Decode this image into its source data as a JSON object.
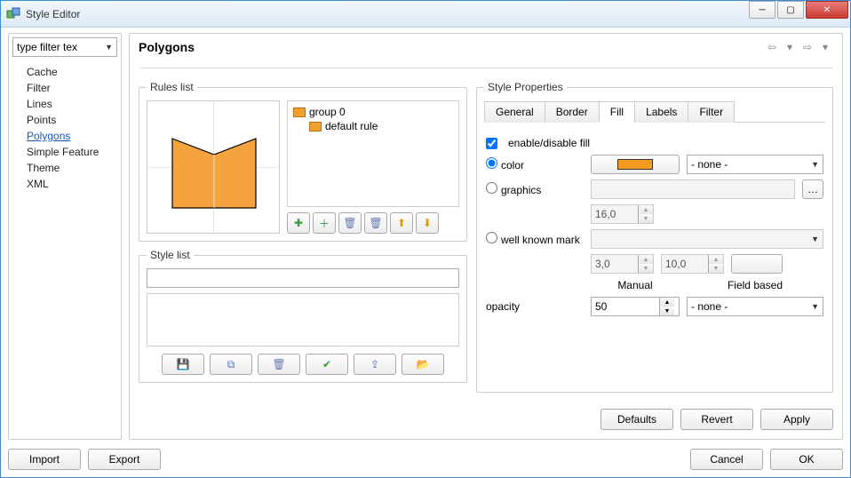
{
  "window": {
    "title": "Style Editor"
  },
  "sidebar": {
    "filter_placeholder": "type filter tex",
    "items": [
      {
        "label": "Cache"
      },
      {
        "label": "Filter"
      },
      {
        "label": "Lines"
      },
      {
        "label": "Points"
      },
      {
        "label": "Polygons",
        "selected": true
      },
      {
        "label": "Simple Feature"
      },
      {
        "label": "Theme"
      },
      {
        "label": "XML"
      }
    ]
  },
  "page": {
    "title": "Polygons"
  },
  "rules": {
    "legend": "Rules list",
    "tree": {
      "group_label": "group 0",
      "rule_label": "default rule"
    }
  },
  "style_list": {
    "legend": "Style list"
  },
  "props": {
    "legend": "Style Properties",
    "tabs": {
      "general": "General",
      "border": "Border",
      "fill": "Fill",
      "labels": "Labels",
      "filter": "Filter"
    },
    "active_tab": "fill",
    "fill": {
      "enable_label": "enable/disable fill",
      "enable_checked": true,
      "color_label": "color",
      "color_hex": "#f49b20",
      "color_field": "- none -",
      "graphics_label": "graphics",
      "graphics_value": "",
      "graphics_size": "16,0",
      "wkm_label": "well known mark",
      "wkm_value": "",
      "wkm_size": "3,0",
      "wkm_stroke": "10,0",
      "manual_header": "Manual",
      "field_header": "Field based",
      "opacity_label": "opacity",
      "opacity_value": "50",
      "opacity_field": "- none -",
      "radio_selected": "color"
    }
  },
  "buttons": {
    "defaults": "Defaults",
    "revert": "Revert",
    "apply": "Apply",
    "import": "Import",
    "export": "Export",
    "cancel": "Cancel",
    "ok": "OK"
  }
}
